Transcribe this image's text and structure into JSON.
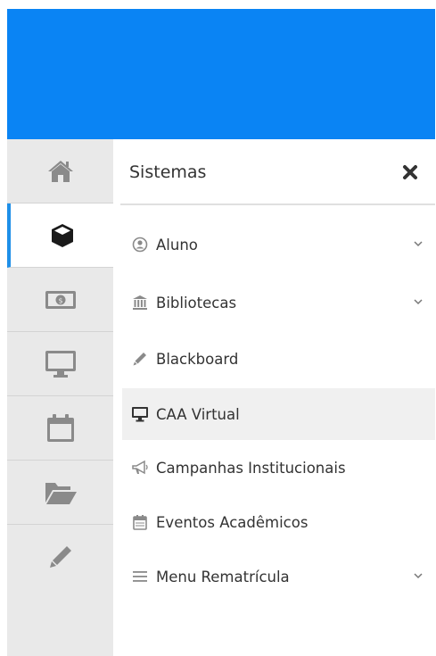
{
  "header": {
    "bar_color": "#0a84f4"
  },
  "rail": {
    "items": [
      {
        "icon": "home-icon"
      },
      {
        "icon": "cube-icon",
        "active": true
      },
      {
        "icon": "money-icon"
      },
      {
        "icon": "monitor-icon"
      },
      {
        "icon": "calendar-icon"
      },
      {
        "icon": "folder-open-icon"
      },
      {
        "icon": "pencil-icon"
      }
    ]
  },
  "panel": {
    "title": "Sistemas",
    "close_icon": "close-icon",
    "items": [
      {
        "label": "Aluno",
        "icon": "user-circle-icon",
        "expandable": true
      },
      {
        "label": "Bibliotecas",
        "icon": "bank-icon",
        "expandable": true
      },
      {
        "label": "Blackboard",
        "icon": "pencil-icon",
        "expandable": false
      },
      {
        "label": "CAA Virtual",
        "icon": "desktop-icon",
        "expandable": false,
        "highlighted": true
      },
      {
        "label": "Campanhas Institucionais",
        "icon": "bullhorn-icon",
        "expandable": false
      },
      {
        "label": "Eventos Acadêmicos",
        "icon": "calendar-icon",
        "expandable": false
      },
      {
        "label": "Menu Rematrícula",
        "icon": "bars-icon",
        "expandable": true
      }
    ]
  },
  "colors": {
    "accent": "#1e8fe8",
    "rail_bg": "#e9e9e9",
    "highlight": "#f0f0f0"
  }
}
